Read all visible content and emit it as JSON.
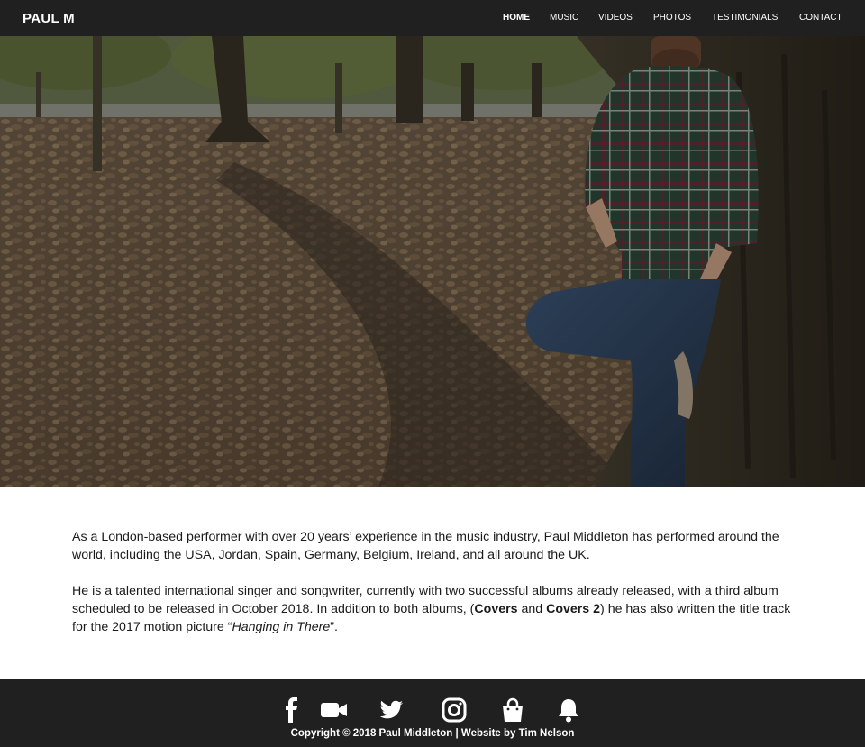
{
  "header": {
    "brand": "PAUL M",
    "nav": [
      {
        "label": "HOME",
        "active": true
      },
      {
        "label": "MUSIC",
        "active": false
      },
      {
        "label": "VIDEOS",
        "active": false
      },
      {
        "label": "PHOTOS",
        "active": false
      },
      {
        "label": "TESTIMONIALS",
        "active": false
      },
      {
        "label": "CONTACT",
        "active": false
      }
    ]
  },
  "content": {
    "p1": "As a London-based performer with over 20 years’ experience in the music industry, Paul Middleton has performed around the world, including the USA, Jordan, Spain, Germany, Belgium, Ireland, and all around the UK.",
    "p2_a": "He is a talented international singer and songwriter, currently with two successful albums already released, with a third album scheduled to be released in October 2018. In addition to both albums, (",
    "p2_b": "Covers",
    "p2_c": " and ",
    "p2_d": "Covers 2",
    "p2_e": ") he has also written the title track for the 2017 motion picture “",
    "p2_f": "Hanging in There",
    "p2_g": "”."
  },
  "footer": {
    "social_icons": [
      "facebook-icon",
      "video-camera-icon",
      "twitter-icon",
      "instagram-icon",
      "shopping-bag-icon",
      "bell-icon"
    ],
    "copyright": "Copyright © 2018 Paul Middleton | Website by Tim Nelson"
  },
  "colors": {
    "header_bg": "#202020",
    "footer_bg": "#202020",
    "text": "#1a1a1a"
  }
}
